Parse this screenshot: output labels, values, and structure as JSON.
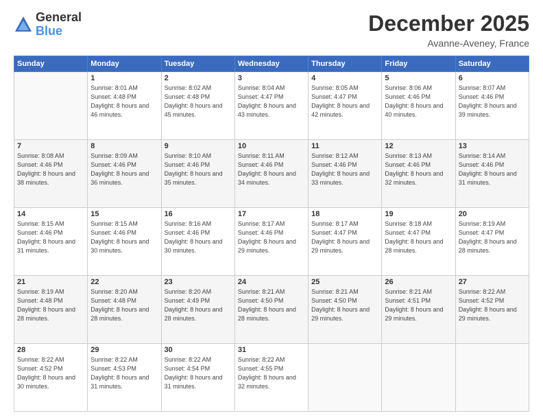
{
  "logo": {
    "general": "General",
    "blue": "Blue"
  },
  "header": {
    "month": "December 2025",
    "location": "Avanne-Aveney, France"
  },
  "weekdays": [
    "Sunday",
    "Monday",
    "Tuesday",
    "Wednesday",
    "Thursday",
    "Friday",
    "Saturday"
  ],
  "weeks": [
    [
      {
        "day": "",
        "sunrise": "",
        "sunset": "",
        "daylight": ""
      },
      {
        "day": "1",
        "sunrise": "Sunrise: 8:01 AM",
        "sunset": "Sunset: 4:48 PM",
        "daylight": "Daylight: 8 hours and 46 minutes."
      },
      {
        "day": "2",
        "sunrise": "Sunrise: 8:02 AM",
        "sunset": "Sunset: 4:48 PM",
        "daylight": "Daylight: 8 hours and 45 minutes."
      },
      {
        "day": "3",
        "sunrise": "Sunrise: 8:04 AM",
        "sunset": "Sunset: 4:47 PM",
        "daylight": "Daylight: 8 hours and 43 minutes."
      },
      {
        "day": "4",
        "sunrise": "Sunrise: 8:05 AM",
        "sunset": "Sunset: 4:47 PM",
        "daylight": "Daylight: 8 hours and 42 minutes."
      },
      {
        "day": "5",
        "sunrise": "Sunrise: 8:06 AM",
        "sunset": "Sunset: 4:46 PM",
        "daylight": "Daylight: 8 hours and 40 minutes."
      },
      {
        "day": "6",
        "sunrise": "Sunrise: 8:07 AM",
        "sunset": "Sunset: 4:46 PM",
        "daylight": "Daylight: 8 hours and 39 minutes."
      }
    ],
    [
      {
        "day": "7",
        "sunrise": "Sunrise: 8:08 AM",
        "sunset": "Sunset: 4:46 PM",
        "daylight": "Daylight: 8 hours and 38 minutes."
      },
      {
        "day": "8",
        "sunrise": "Sunrise: 8:09 AM",
        "sunset": "Sunset: 4:46 PM",
        "daylight": "Daylight: 8 hours and 36 minutes."
      },
      {
        "day": "9",
        "sunrise": "Sunrise: 8:10 AM",
        "sunset": "Sunset: 4:46 PM",
        "daylight": "Daylight: 8 hours and 35 minutes."
      },
      {
        "day": "10",
        "sunrise": "Sunrise: 8:11 AM",
        "sunset": "Sunset: 4:46 PM",
        "daylight": "Daylight: 8 hours and 34 minutes."
      },
      {
        "day": "11",
        "sunrise": "Sunrise: 8:12 AM",
        "sunset": "Sunset: 4:46 PM",
        "daylight": "Daylight: 8 hours and 33 minutes."
      },
      {
        "day": "12",
        "sunrise": "Sunrise: 8:13 AM",
        "sunset": "Sunset: 4:46 PM",
        "daylight": "Daylight: 8 hours and 32 minutes."
      },
      {
        "day": "13",
        "sunrise": "Sunrise: 8:14 AM",
        "sunset": "Sunset: 4:46 PM",
        "daylight": "Daylight: 8 hours and 31 minutes."
      }
    ],
    [
      {
        "day": "14",
        "sunrise": "Sunrise: 8:15 AM",
        "sunset": "Sunset: 4:46 PM",
        "daylight": "Daylight: 8 hours and 31 minutes."
      },
      {
        "day": "15",
        "sunrise": "Sunrise: 8:15 AM",
        "sunset": "Sunset: 4:46 PM",
        "daylight": "Daylight: 8 hours and 30 minutes."
      },
      {
        "day": "16",
        "sunrise": "Sunrise: 8:16 AM",
        "sunset": "Sunset: 4:46 PM",
        "daylight": "Daylight: 8 hours and 30 minutes."
      },
      {
        "day": "17",
        "sunrise": "Sunrise: 8:17 AM",
        "sunset": "Sunset: 4:46 PM",
        "daylight": "Daylight: 8 hours and 29 minutes."
      },
      {
        "day": "18",
        "sunrise": "Sunrise: 8:17 AM",
        "sunset": "Sunset: 4:47 PM",
        "daylight": "Daylight: 8 hours and 29 minutes."
      },
      {
        "day": "19",
        "sunrise": "Sunrise: 8:18 AM",
        "sunset": "Sunset: 4:47 PM",
        "daylight": "Daylight: 8 hours and 28 minutes."
      },
      {
        "day": "20",
        "sunrise": "Sunrise: 8:19 AM",
        "sunset": "Sunset: 4:47 PM",
        "daylight": "Daylight: 8 hours and 28 minutes."
      }
    ],
    [
      {
        "day": "21",
        "sunrise": "Sunrise: 8:19 AM",
        "sunset": "Sunset: 4:48 PM",
        "daylight": "Daylight: 8 hours and 28 minutes."
      },
      {
        "day": "22",
        "sunrise": "Sunrise: 8:20 AM",
        "sunset": "Sunset: 4:48 PM",
        "daylight": "Daylight: 8 hours and 28 minutes."
      },
      {
        "day": "23",
        "sunrise": "Sunrise: 8:20 AM",
        "sunset": "Sunset: 4:49 PM",
        "daylight": "Daylight: 8 hours and 28 minutes."
      },
      {
        "day": "24",
        "sunrise": "Sunrise: 8:21 AM",
        "sunset": "Sunset: 4:50 PM",
        "daylight": "Daylight: 8 hours and 28 minutes."
      },
      {
        "day": "25",
        "sunrise": "Sunrise: 8:21 AM",
        "sunset": "Sunset: 4:50 PM",
        "daylight": "Daylight: 8 hours and 29 minutes."
      },
      {
        "day": "26",
        "sunrise": "Sunrise: 8:21 AM",
        "sunset": "Sunset: 4:51 PM",
        "daylight": "Daylight: 8 hours and 29 minutes."
      },
      {
        "day": "27",
        "sunrise": "Sunrise: 8:22 AM",
        "sunset": "Sunset: 4:52 PM",
        "daylight": "Daylight: 8 hours and 29 minutes."
      }
    ],
    [
      {
        "day": "28",
        "sunrise": "Sunrise: 8:22 AM",
        "sunset": "Sunset: 4:52 PM",
        "daylight": "Daylight: 8 hours and 30 minutes."
      },
      {
        "day": "29",
        "sunrise": "Sunrise: 8:22 AM",
        "sunset": "Sunset: 4:53 PM",
        "daylight": "Daylight: 8 hours and 31 minutes."
      },
      {
        "day": "30",
        "sunrise": "Sunrise: 8:22 AM",
        "sunset": "Sunset: 4:54 PM",
        "daylight": "Daylight: 8 hours and 31 minutes."
      },
      {
        "day": "31",
        "sunrise": "Sunrise: 8:22 AM",
        "sunset": "Sunset: 4:55 PM",
        "daylight": "Daylight: 8 hours and 32 minutes."
      },
      {
        "day": "",
        "sunrise": "",
        "sunset": "",
        "daylight": ""
      },
      {
        "day": "",
        "sunrise": "",
        "sunset": "",
        "daylight": ""
      },
      {
        "day": "",
        "sunrise": "",
        "sunset": "",
        "daylight": ""
      }
    ]
  ]
}
